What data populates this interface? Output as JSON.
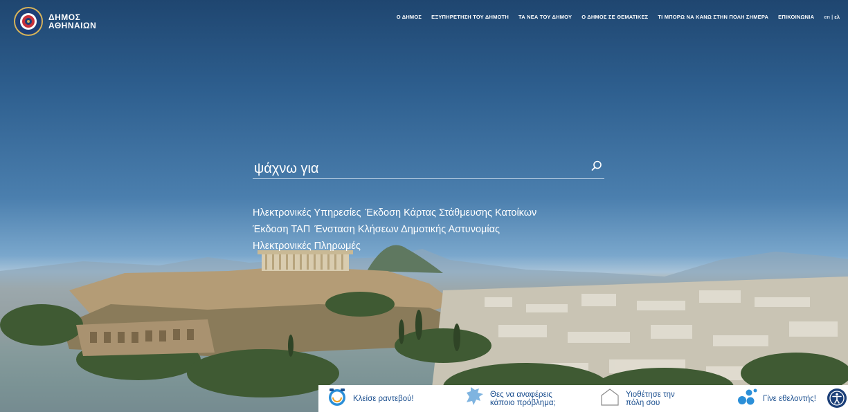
{
  "header": {
    "logo_line1": "ΔΗΜΟΣ",
    "logo_line2": "ΑΘΗΝΑΙΩΝ",
    "nav": [
      "Ο ΔΗΜΟΣ",
      "ΕΞΥΠΗΡΕΤΗΣΗ ΤΟΥ ΔΗΜΟΤΗ",
      "ΤΑ ΝΕΑ ΤΟΥ ΔΗΜΟΥ",
      "Ο ΔΗΜΟΣ ΣΕ ΘΕΜΑΤΙΚΕΣ",
      "ΤΙ ΜΠΟΡΩ ΝΑ ΚΑΝΩ ΣΤΗΝ ΠΟΛΗ ΣΗΜΕΡΑ",
      "ΕΠΙΚΟΙΝΩΝΙΑ"
    ],
    "lang_en": "en",
    "lang_sep": "|",
    "lang_el": "ελ"
  },
  "search": {
    "placeholder": "ψάχνω για",
    "icon": "search-icon"
  },
  "quick_links": {
    "row1": [
      "Ηλεκτρονικές Υπηρεσίες",
      "Έκδοση Κάρτας Στάθμευσης Κατοίκων"
    ],
    "row2": [
      "Έκδοση ΤΑΠ",
      "Ένσταση Κλήσεων Δημοτικής Αστυνομίας"
    ],
    "row3": [
      "Ηλεκτρονικές Πληρωμές"
    ]
  },
  "bottom_bar": {
    "appointment": "Κλείσε ραντεβού!",
    "report_line1": "Θες να αναφέρεις",
    "report_line2": "κάποιο πρόβλημα;",
    "adopt_line1": "Υιοθέτησε την",
    "adopt_line2": "πόλη σου",
    "volunteer": "Γίνε εθελοντής!"
  },
  "colors": {
    "brand_blue": "#1b3f78",
    "link_blue": "#1b4f8f",
    "white": "#ffffff"
  }
}
